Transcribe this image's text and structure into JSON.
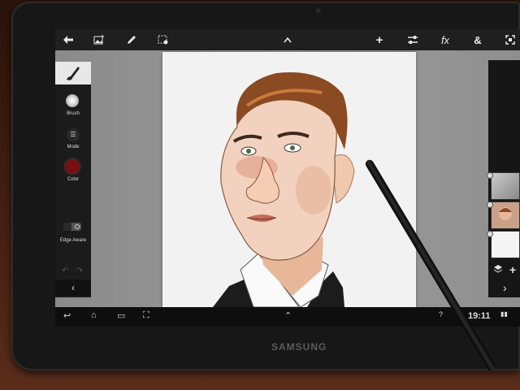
{
  "device": {
    "brand": "SAMSUNG"
  },
  "topbar": {
    "icons": [
      "back-arrow-icon",
      "add-image-icon",
      "pencil-icon",
      "select-icon",
      "chevron-up-icon",
      "add-icon",
      "adjust-icon",
      "effects-icon",
      "ampersand-icon",
      "fullscreen-icon"
    ],
    "fx_label": "fx",
    "amp_label": "&"
  },
  "left_panel": {
    "brush_label": "Brush",
    "mode_label": "Mode",
    "color_label": "Color",
    "edge_aware_label": "Edge Aware",
    "collapse_glyph": "‹",
    "color_value": "#7a0f0f"
  },
  "right_panel": {
    "add_layer_glyph": "+",
    "collapse_glyph": "›"
  },
  "system_bar": {
    "time": "19:11",
    "back_glyph": "↩",
    "home_glyph": "⌂",
    "recents_glyph": "▭",
    "screenshot_glyph": "⛶",
    "up_glyph": "⌃"
  }
}
